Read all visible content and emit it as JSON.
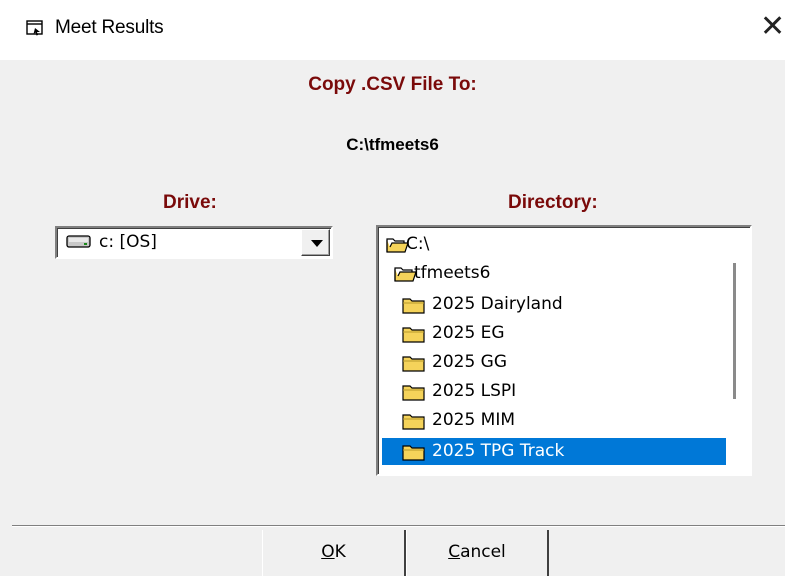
{
  "window": {
    "title": "Meet Results",
    "icon": "window-app-icon",
    "close_glyph": "✕"
  },
  "dialog": {
    "copy_heading": "Copy .CSV File To:",
    "destination_path": "C:\\tfmeets6",
    "drive_label": "Drive:",
    "directory_label": "Directory:"
  },
  "drive": {
    "selected": "c: [OS]",
    "icon": "hard-drive-icon"
  },
  "directories": [
    {
      "label": "C:\\",
      "icon": "open-folder-icon",
      "selected": false
    },
    {
      "label": "tfmeets6",
      "icon": "open-folder-icon",
      "selected": false
    },
    {
      "label": "2025 Dairyland",
      "icon": "folder-icon",
      "selected": false
    },
    {
      "label": "2025 EG",
      "icon": "folder-icon",
      "selected": false
    },
    {
      "label": "2025 GG",
      "icon": "folder-icon",
      "selected": false
    },
    {
      "label": "2025 LSPI",
      "icon": "folder-icon",
      "selected": false
    },
    {
      "label": "2025 MIM",
      "icon": "folder-icon",
      "selected": false
    },
    {
      "label": "2025 TPG Track",
      "icon": "folder-icon",
      "selected": true
    }
  ],
  "buttons": {
    "ok": {
      "mnemonic": "O",
      "rest": "K"
    },
    "cancel": {
      "mnemonic": "C",
      "rest": "ancel"
    }
  },
  "colors": {
    "heading_red": "#7a0a0a",
    "selection_blue": "#0078d7",
    "folder_yellow": "#f5d35a"
  }
}
